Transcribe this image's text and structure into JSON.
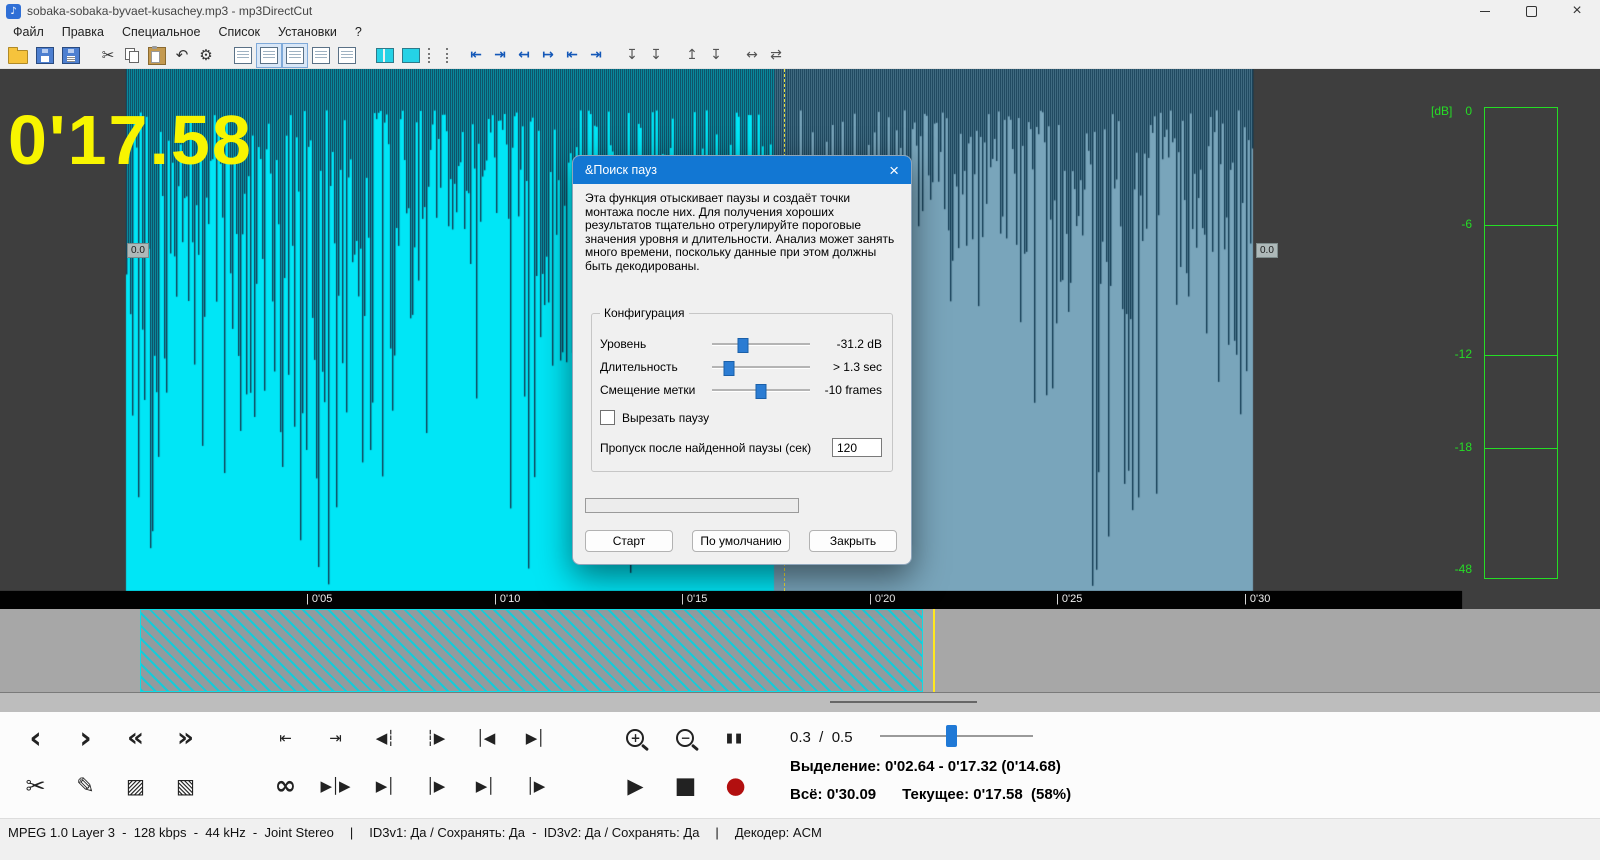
{
  "window": {
    "title": "sobaka-sobaka-byvaet-kusachey.mp3 - mp3DirectCut",
    "app_icon_glyph": "♪",
    "close_glyph": "×"
  },
  "menu": {
    "items": [
      {
        "name": "menu-file",
        "label": "Файл"
      },
      {
        "name": "menu-edit",
        "label": "Правка"
      },
      {
        "name": "menu-special",
        "label": "Специальное"
      },
      {
        "name": "menu-list",
        "label": "Список"
      },
      {
        "name": "menu-settings",
        "label": "Установки"
      },
      {
        "name": "menu-help",
        "label": "?"
      }
    ]
  },
  "toolbar": {
    "groups": [
      {
        "items": [
          {
            "name": "open-file-icon",
            "type": "folder"
          },
          {
            "name": "save-audio-icon",
            "type": "disk"
          },
          {
            "name": "save-list-icon",
            "type": "disk2"
          }
        ]
      },
      {
        "items": [
          {
            "name": "cut-icon",
            "type": "glyph",
            "glyph": "✂"
          },
          {
            "name": "copy-icon",
            "type": "copy"
          },
          {
            "name": "paste-icon",
            "type": "paste"
          },
          {
            "name": "undo-icon",
            "type": "glyph",
            "glyph": "↶"
          },
          {
            "name": "settings-gear-icon",
            "type": "glyph",
            "glyph": "⚙"
          }
        ]
      },
      {
        "items": [
          {
            "name": "doc-view-1-icon",
            "type": "doc"
          },
          {
            "name": "doc-view-2-icon",
            "type": "doc",
            "pressed": true
          },
          {
            "name": "doc-view-3-icon",
            "type": "doc",
            "pressed": true
          },
          {
            "name": "doc-view-4-icon",
            "type": "doc"
          },
          {
            "name": "doc-view-5-icon",
            "type": "doc"
          }
        ]
      },
      {
        "items": [
          {
            "name": "vu-stereo-icon",
            "type": "vu2"
          },
          {
            "name": "vu-mono-icon",
            "type": "vu1"
          },
          {
            "name": "grid-dots-icon",
            "type": "dots"
          }
        ]
      },
      {
        "items": [
          {
            "name": "cue-left-icon",
            "type": "arrow",
            "glyph": "⇤"
          },
          {
            "name": "cue-right-icon",
            "type": "arrow",
            "glyph": "⇥"
          },
          {
            "name": "edge-left-icon",
            "type": "arrow",
            "glyph": "↤"
          },
          {
            "name": "edge-right-icon",
            "type": "arrow",
            "glyph": "↦"
          },
          {
            "name": "snap-left-icon",
            "type": "arrow",
            "glyph": "⇤"
          },
          {
            "name": "snap-right-icon",
            "type": "arrow",
            "glyph": "⇥"
          }
        ]
      },
      {
        "items": [
          {
            "name": "marker-drop-1-icon",
            "type": "glyph2",
            "glyph": "↧"
          },
          {
            "name": "marker-drop-2-icon",
            "type": "glyph2",
            "glyph": "↧"
          }
        ]
      },
      {
        "items": [
          {
            "name": "level-up-icon",
            "type": "glyph2",
            "glyph": "↥"
          },
          {
            "name": "level-down-icon",
            "type": "glyph2",
            "glyph": "↧"
          }
        ]
      },
      {
        "items": [
          {
            "name": "expand-horizontal-icon",
            "type": "glyph2",
            "glyph": "↔"
          },
          {
            "name": "swap-direction-icon",
            "type": "glyph2",
            "glyph": "⇄"
          }
        ]
      }
    ]
  },
  "waveform": {
    "time_display": "0'17.58",
    "gain_left": "0.0",
    "gain_right": "0.0",
    "ticks": [
      "| 0'05",
      "| 0'10",
      "| 0'15",
      "| 0'20",
      "| 0'25",
      "| 0'30"
    ],
    "db_label": "[dB]",
    "db_ticks": [
      "0",
      "-6",
      "-12",
      "-18",
      "-48"
    ]
  },
  "dialog": {
    "title": "&Поиск пауз",
    "close": "×",
    "description": "Эта функция отыскивает паузы и создаёт точки монтажа после них. Для получения хороших результатов тщательно отрегулируйте пороговые значения уровня и длительности. Анализ может занять много времени, поскольку данные при этом должны быть декодированы.",
    "group_title": "Конфигурация",
    "sliders": [
      {
        "label": "Уровень",
        "value": "-31.2 dB",
        "pos": 0.32
      },
      {
        "label": "Длительность",
        "value": "> 1.3 sec",
        "pos": 0.17
      },
      {
        "label": "Смещение метки",
        "value": "-10 frames",
        "pos": 0.5
      }
    ],
    "checkbox": {
      "label": "Вырезать паузу",
      "checked": false
    },
    "skip": {
      "label": "Пропуск после найденной паузы (сек)",
      "value": "120"
    },
    "buttons": [
      {
        "name": "start-button",
        "label": "Старт"
      },
      {
        "name": "defaults-button",
        "label": "По умолчанию"
      },
      {
        "name": "close-dialog-button",
        "label": "Закрыть"
      }
    ]
  },
  "transport": {
    "row1": [
      {
        "name": "step-back-button",
        "glyph": "‹"
      },
      {
        "name": "step-forward-button",
        "glyph": "›"
      },
      {
        "name": "fast-back-button",
        "glyph": "«"
      },
      {
        "name": "fast-forward-button",
        "glyph": "»"
      },
      {
        "name": "jump-start-button",
        "glyph": "⇤",
        "gap": true
      },
      {
        "name": "jump-end-button",
        "glyph": "⇥"
      },
      {
        "name": "sel-start-button",
        "glyph": "◀┆"
      },
      {
        "name": "sel-end-button",
        "glyph": "┆▶"
      },
      {
        "name": "prev-cue-button",
        "glyph": "│◀"
      },
      {
        "name": "next-cue-button",
        "glyph": "▶│"
      },
      {
        "name": "zoom-in-button",
        "type": "zoom",
        "glyph": "+",
        "gap": true
      },
      {
        "name": "zoom-out-button",
        "type": "zoom",
        "glyph": "−"
      },
      {
        "name": "pause-button",
        "glyph": "▮▮"
      }
    ],
    "row2": [
      {
        "name": "cut-button",
        "glyph": "✂"
      },
      {
        "name": "edit-button",
        "glyph": "✎"
      },
      {
        "name": "sel-begin-button",
        "glyph": "▨"
      },
      {
        "name": "sel-finish-button",
        "glyph": "▧"
      },
      {
        "name": "loop-button",
        "glyph": "∞",
        "gap": true
      },
      {
        "name": "play-skip-button",
        "glyph": "▶│▶"
      },
      {
        "name": "play-to-cut-button",
        "glyph": "▶│"
      },
      {
        "name": "play-from-cut-button",
        "glyph": "│▶"
      },
      {
        "name": "play-before-button",
        "glyph": "▶│"
      },
      {
        "name": "play-after-button",
        "glyph": "│▶"
      },
      {
        "name": "play-button",
        "glyph": "▶",
        "gap": true
      },
      {
        "name": "stop-button",
        "glyph": "■"
      },
      {
        "name": "record-button",
        "glyph": "●"
      }
    ],
    "zoom_text": "0.3  /  0.5",
    "selection_label": "Выделение:",
    "selection_value": "0'02.64 - 0'17.32 (0'14.68)",
    "total_label": "Всё:",
    "total_value": "0'30.09",
    "current_label": "Текущее:",
    "current_value": "0'17.58  (58%)"
  },
  "statusbar": {
    "format": "MPEG 1.0 Layer 3  -  128 kbps  -  44 kHz  -  Joint Stereo",
    "sep1": "|",
    "id3": "ID3v1: Да / Сохранять: Да  -  ID3v2: Да / Сохранять: Да",
    "sep2": "|",
    "decoder": "Декодер: ACM"
  }
}
